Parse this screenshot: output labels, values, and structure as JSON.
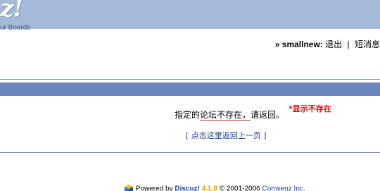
{
  "header": {
    "logo_mark": "z!",
    "tagline": "ur Boards"
  },
  "userbar": {
    "raquo": "»",
    "username": "smallnew:",
    "logout": "退出",
    "separator": "|",
    "pm": "短消息"
  },
  "message": {
    "prefix": "指定的",
    "underlined": "论坛不存在，",
    "suffix": "请返回。",
    "annotation": "*显示不存在",
    "back_link": "[ 点击这里返回上一页 ]"
  },
  "footer": {
    "powered": "Powered by",
    "brand": "Discuz!",
    "version": "4.1.0",
    "copyright": "© 2001-2006",
    "company": "Comsenz Inc."
  },
  "colors": {
    "header_bg": "#a7b9d9",
    "bluebar_bg": "#6b86bd",
    "annotation": "#d01010",
    "link": "#1f3f91"
  }
}
